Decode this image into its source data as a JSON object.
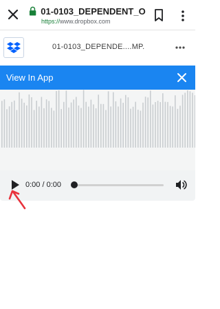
{
  "browser": {
    "page_title": "01-0103_DEPENDENT_O...",
    "url_scheme": "https://",
    "url_host": "www.dropbox.com"
  },
  "file_header": {
    "file_name": "01-0103_DEPENDE....MP."
  },
  "banner": {
    "text": "View In App",
    "color": "#1a85f1"
  },
  "audio_player": {
    "time_display": "0:00 / 0:00",
    "progress": 0
  },
  "icons": {
    "close": "close-icon",
    "lock": "lock-icon",
    "bookmark": "bookmark-icon",
    "menu": "more-vert-icon",
    "logo": "dropbox-logo",
    "file_menu": "more-horiz-icon",
    "banner_close": "close-icon",
    "play": "play-icon",
    "volume": "volume-icon"
  }
}
